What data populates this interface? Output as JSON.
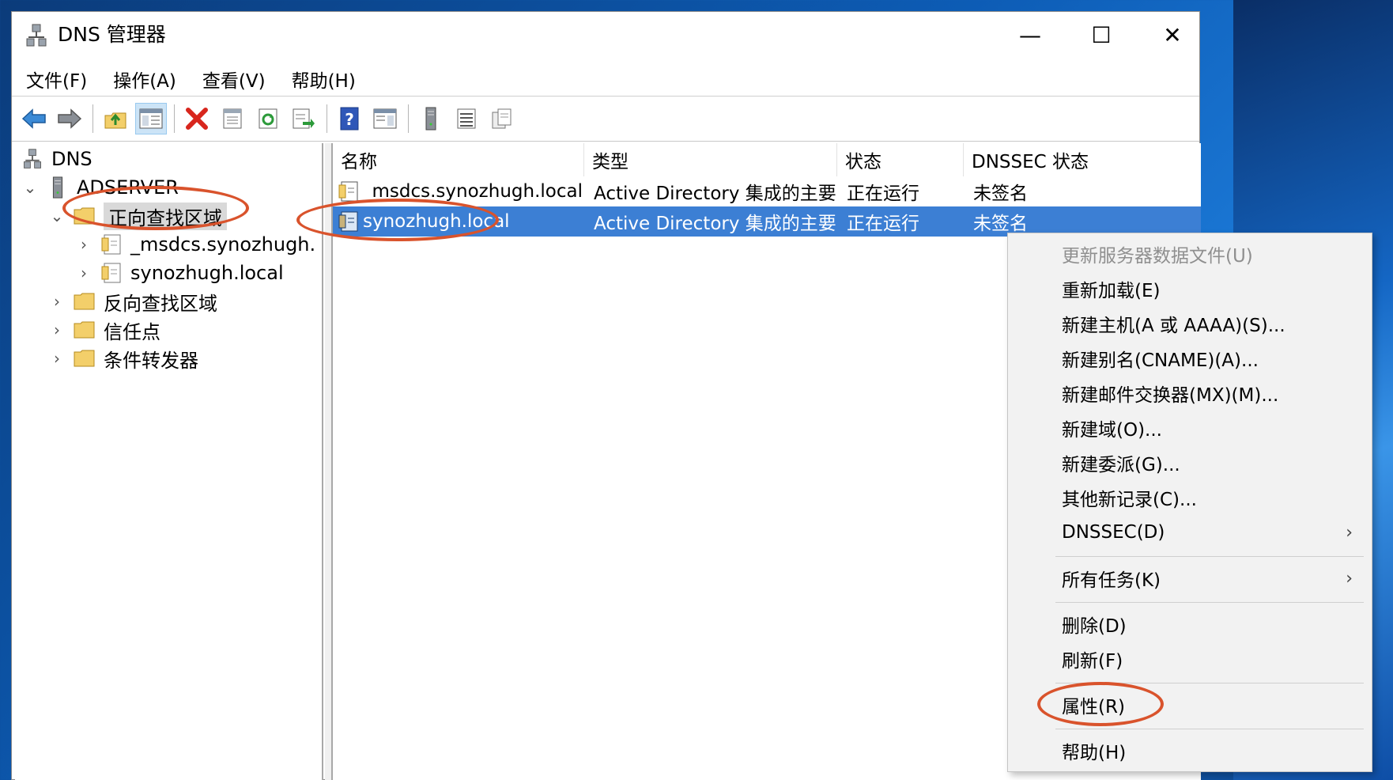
{
  "window": {
    "title": "DNS 管理器",
    "controls": {
      "minimize": "—",
      "maximize": "☐",
      "close": "✕"
    }
  },
  "menubar": [
    {
      "label": "文件(F)"
    },
    {
      "label": "操作(A)"
    },
    {
      "label": "查看(V)"
    },
    {
      "label": "帮助(H)"
    }
  ],
  "toolbar": [
    "back-arrow-icon",
    "forward-arrow-icon",
    "up-folder-icon",
    "show-hide-tree-icon",
    "delete-icon",
    "properties-icon",
    "refresh-icon",
    "export-list-icon",
    "help-icon",
    "show-hide-action-pane-icon",
    "server-icon",
    "list-view-icon",
    "copy-icon"
  ],
  "tree": {
    "root": "DNS",
    "server": "ADSERVER",
    "forward_zones": "正向查找区域",
    "zone_msdcs": "_msdcs.synozhugh.",
    "zone_local": "synozhugh.local",
    "reverse_zones": "反向查找区域",
    "trust_points": "信任点",
    "conditional_forwarders": "条件转发器"
  },
  "list": {
    "columns": [
      "名称",
      "类型",
      "状态",
      "DNSSEC 状态"
    ],
    "rows": [
      {
        "name": "_msdcs.synozhugh.local",
        "type": "Active Directory 集成的主要...",
        "status": "正在运行",
        "dnssec": "未签名"
      },
      {
        "name": "synozhugh.local",
        "type": "Active Directory 集成的主要...",
        "status": "正在运行",
        "dnssec": "未签名"
      }
    ]
  },
  "context_menu": {
    "update_server_file": "更新服务器数据文件(U)",
    "reload": "重新加载(E)",
    "new_host": "新建主机(A 或 AAAA)(S)...",
    "new_alias": "新建别名(CNAME)(A)...",
    "new_mx": "新建邮件交换器(MX)(M)...",
    "new_domain": "新建域(O)...",
    "new_delegation": "新建委派(G)...",
    "other_records": "其他新记录(C)...",
    "dnssec": "DNSSEC(D)",
    "all_tasks": "所有任务(K)",
    "delete": "删除(D)",
    "refresh": "刷新(F)",
    "properties": "属性(R)",
    "help": "帮助(H)",
    "submenu_arrow": "›"
  },
  "colors": {
    "selection": "#3c7fd4",
    "annotation_red": "#d9532c",
    "folder_yellow": "#f3cf6a"
  }
}
